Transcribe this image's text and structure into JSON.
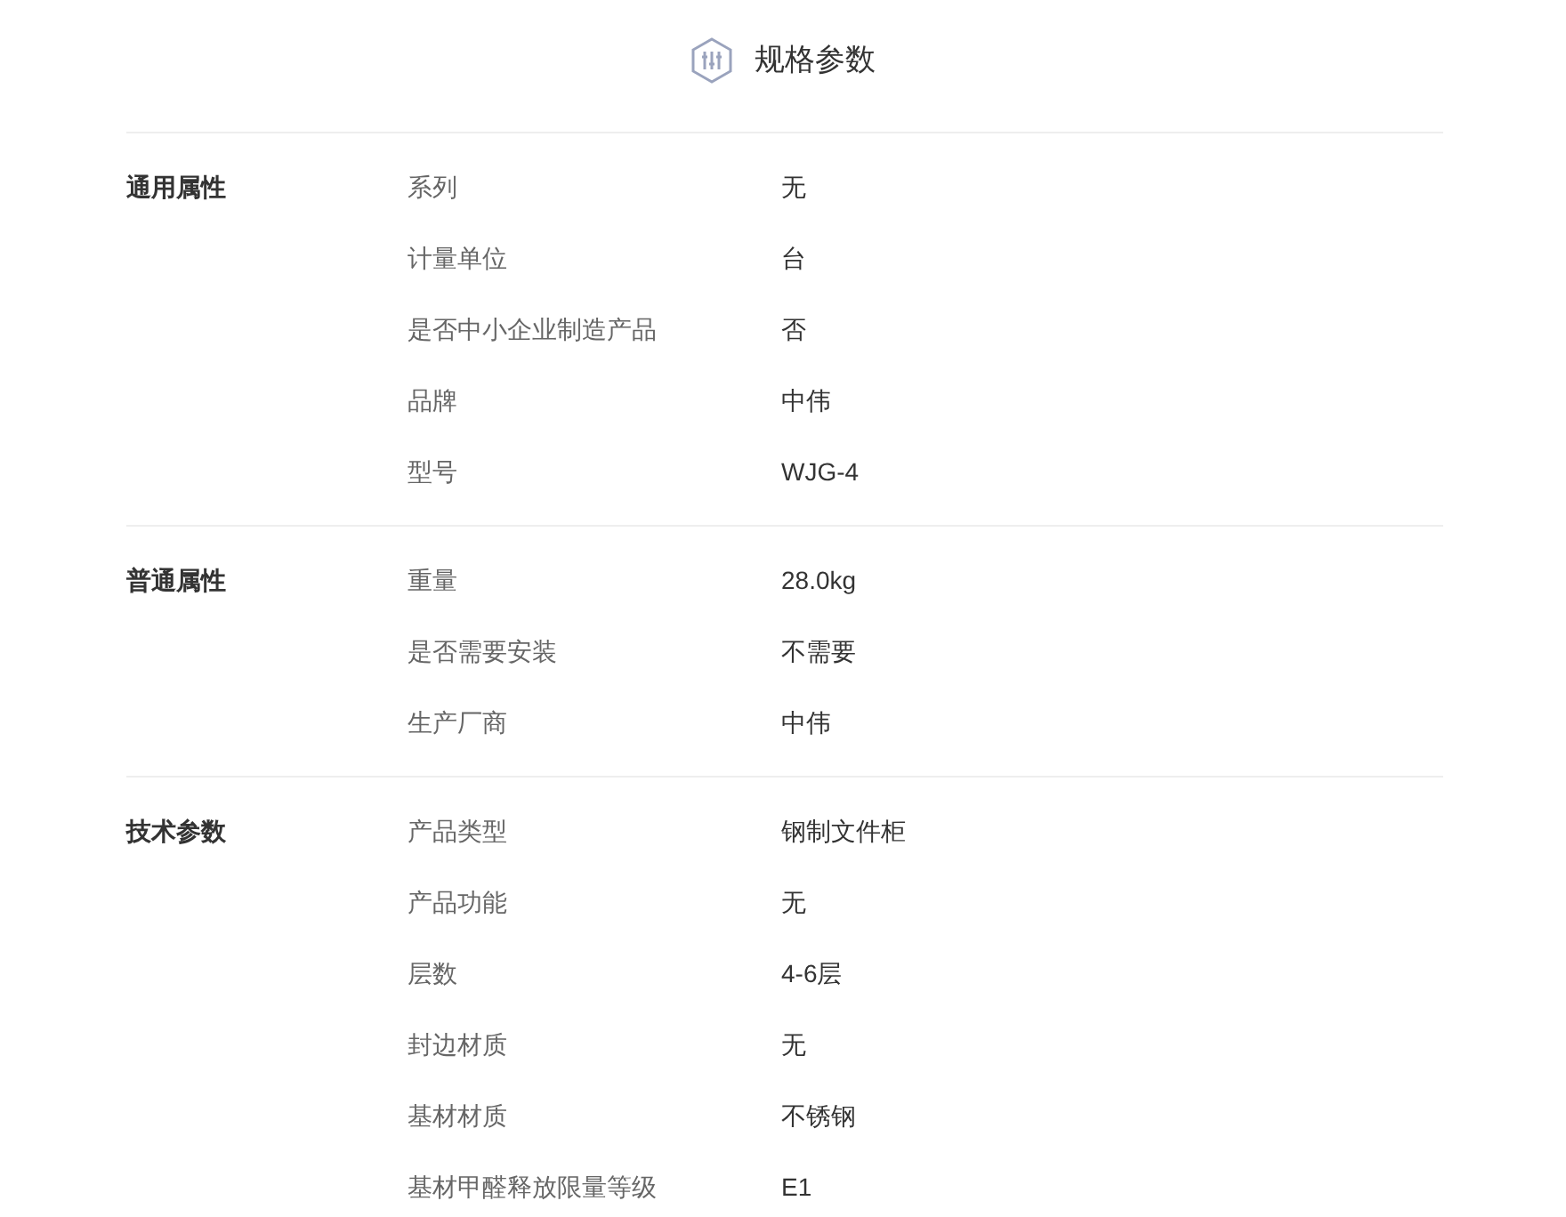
{
  "title": "规格参数",
  "groups": [
    {
      "name": "通用属性",
      "rows": [
        {
          "key": "系列",
          "value": "无"
        },
        {
          "key": "计量单位",
          "value": "台"
        },
        {
          "key": "是否中小企业制造产品",
          "value": "否"
        },
        {
          "key": "品牌",
          "value": "中伟"
        },
        {
          "key": "型号",
          "value": "WJG-4"
        }
      ]
    },
    {
      "name": "普通属性",
      "rows": [
        {
          "key": "重量",
          "value": "28.0kg"
        },
        {
          "key": "是否需要安装",
          "value": "不需要"
        },
        {
          "key": "生产厂商",
          "value": "中伟"
        }
      ]
    },
    {
      "name": "技术参数",
      "rows": [
        {
          "key": "产品类型",
          "value": "钢制文件柜"
        },
        {
          "key": "产品功能",
          "value": "无"
        },
        {
          "key": "层数",
          "value": "4-6层"
        },
        {
          "key": "封边材质",
          "value": "无"
        },
        {
          "key": "基材材质",
          "value": "不锈钢"
        },
        {
          "key": "基材甲醛释放限量等级",
          "value": "E1"
        }
      ]
    }
  ]
}
